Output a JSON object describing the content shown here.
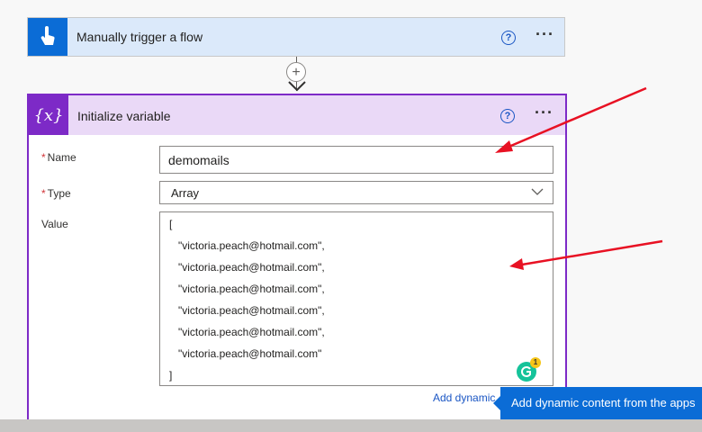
{
  "trigger_card": {
    "title": "Manually trigger a flow",
    "help_icon": "?",
    "more_icon": "···",
    "icon": "hand-pointer-icon"
  },
  "connector": {
    "add_icon": "+"
  },
  "init_card": {
    "title": "Initialize variable",
    "icon_text": "{x}",
    "help_icon": "?",
    "more_icon": "···",
    "name_label": "Name",
    "name_value": "demomails",
    "type_label": "Type",
    "type_value": "Array",
    "value_label": "Value",
    "required_mark": "*",
    "value_lines": [
      "[",
      "  \"victoria.peach@hotmail.com\",",
      "  \"victoria.peach@hotmail.com\",",
      "  \"victoria.peach@hotmail.com\",",
      "  \"victoria.peach@hotmail.com\",",
      "  \"victoria.peach@hotmail.com\",",
      "  \"victoria.peach@hotmail.com\"",
      "]"
    ],
    "add_dynamic_link": "Add dynamic",
    "grammarly_badge": "1"
  },
  "tooltip": {
    "text": "Add dynamic content from the apps"
  },
  "colors": {
    "trigger_header": "#dbe9fa",
    "trigger_icon_bg": "#0b6cd6",
    "init_header": "#ead9f7",
    "init_accent": "#7d2ac7",
    "annotation_arrow": "#e81123"
  }
}
